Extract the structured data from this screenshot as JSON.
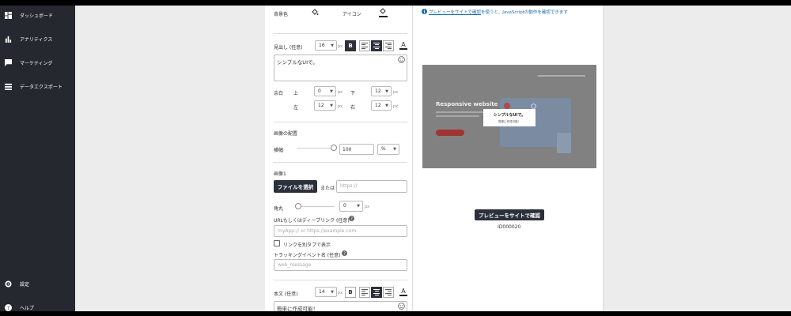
{
  "sidebar": {
    "items": [
      {
        "label": "ダッシュボード",
        "icon": "dashboard-icon"
      },
      {
        "label": "アナリティクス",
        "icon": "bar-chart-icon"
      },
      {
        "label": "マーケティング",
        "icon": "chat-icon"
      },
      {
        "label": "データエクスポート",
        "icon": "list-icon"
      }
    ],
    "bottom": [
      {
        "label": "設定",
        "icon": "gear-icon"
      },
      {
        "label": "ヘルプ",
        "icon": "help-icon"
      }
    ]
  },
  "editor": {
    "bg_color_label": "背景色",
    "icon_label": "アイコン",
    "heading": {
      "label": "見出し (任意)",
      "font_size": "16",
      "unit": "px",
      "bold": "B",
      "text": "シンプルなUIで。",
      "margin_label": "余白",
      "top_label": "上",
      "top_value": "0",
      "bottom_label": "下",
      "bottom_value": "12",
      "left_label": "左",
      "left_value": "12",
      "right_label": "右",
      "right_value": "12"
    },
    "image_layout": {
      "label": "画像の配置",
      "width_label": "横幅",
      "width_value": "100",
      "width_unit": "%"
    },
    "image1": {
      "label": "画像1",
      "choose_file": "ファイルを選択",
      "or": "または",
      "url_placeholder": "https://",
      "radius_label": "角丸",
      "radius_value": "0",
      "unit": "px",
      "link_label": "URLもしくはディープリンク (任意)",
      "link_placeholder": "myApp:// or https://example.com",
      "new_tab_label": "リンクを別タブで表示",
      "tracking_label": "トラッキングイベント名 (任意)",
      "tracking_placeholder": "web_message"
    },
    "body": {
      "label": "本文 (任意)",
      "font_size": "14",
      "unit": "px",
      "bold": "B",
      "text": "簡単に作成可能！"
    }
  },
  "preview": {
    "info_link": "プレビューをサイトで確認",
    "info_rest": "を使うと、JavaScriptの動作を確認できます",
    "mock_title": "Responsive website",
    "popup_heading": "シンプルなUIで。",
    "popup_body": "簡単に作成可能！",
    "button": "プレビューをサイトで確認",
    "id": "ID000020"
  },
  "colors": {
    "sidebar": "#25292f",
    "dark_button": "#2b303b",
    "link": "#1a6fb0",
    "mock_accent": "#e0514f"
  }
}
